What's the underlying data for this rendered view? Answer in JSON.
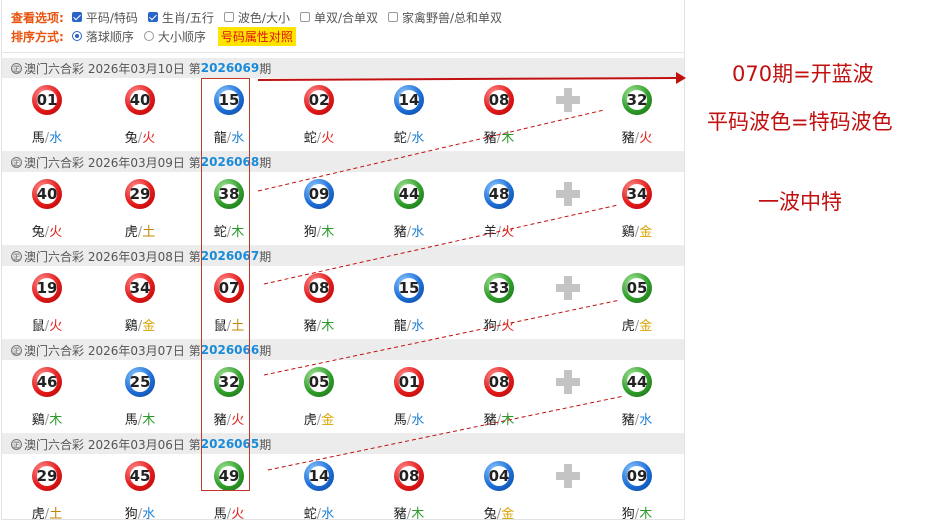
{
  "options": {
    "view_title": "查看选项:",
    "view_items": [
      {
        "label": "平码/特码",
        "checked": true
      },
      {
        "label": "生肖/五行",
        "checked": true
      },
      {
        "label": "波色/大小",
        "checked": false
      },
      {
        "label": "单双/合单双",
        "checked": false
      },
      {
        "label": "家禽野兽/总和单双",
        "checked": false
      }
    ],
    "sort_title": "排序方式:",
    "sort_items": [
      {
        "label": "落球顺序",
        "selected": true
      },
      {
        "label": "大小顺序",
        "selected": false
      }
    ],
    "attr_button": "号码属性对照"
  },
  "draws": [
    {
      "lottery": "澳门六合彩",
      "date": "2026年03月10日",
      "prefix": "第",
      "number": "2026069",
      "suffix": "期",
      "logo": "㊣",
      "balls": [
        {
          "n": "01",
          "c": "red",
          "zodiac": "馬",
          "el": "水"
        },
        {
          "n": "40",
          "c": "red",
          "zodiac": "兔",
          "el": "火"
        },
        {
          "n": "15",
          "c": "blue",
          "zodiac": "龍",
          "el": "水"
        },
        {
          "n": "02",
          "c": "red",
          "zodiac": "蛇",
          "el": "火"
        },
        {
          "n": "14",
          "c": "blue",
          "zodiac": "蛇",
          "el": "水"
        },
        {
          "n": "08",
          "c": "red",
          "zodiac": "豬",
          "el": "木"
        }
      ],
      "special": {
        "n": "32",
        "c": "green",
        "zodiac": "豬",
        "el": "火"
      }
    },
    {
      "lottery": "澳门六合彩",
      "date": "2026年03月09日",
      "prefix": "第",
      "number": "2026068",
      "suffix": "期",
      "logo": "㊣",
      "balls": [
        {
          "n": "40",
          "c": "red",
          "zodiac": "兔",
          "el": "火"
        },
        {
          "n": "29",
          "c": "red",
          "zodiac": "虎",
          "el": "土"
        },
        {
          "n": "38",
          "c": "green",
          "zodiac": "蛇",
          "el": "木"
        },
        {
          "n": "09",
          "c": "blue",
          "zodiac": "狗",
          "el": "木"
        },
        {
          "n": "44",
          "c": "green",
          "zodiac": "豬",
          "el": "水"
        },
        {
          "n": "48",
          "c": "blue",
          "zodiac": "羊",
          "el": "火"
        }
      ],
      "special": {
        "n": "34",
        "c": "red",
        "zodiac": "鷄",
        "el": "金"
      }
    },
    {
      "lottery": "澳门六合彩",
      "date": "2026年03月08日",
      "prefix": "第",
      "number": "2026067",
      "suffix": "期",
      "logo": "㊣",
      "balls": [
        {
          "n": "19",
          "c": "red",
          "zodiac": "鼠",
          "el": "火"
        },
        {
          "n": "34",
          "c": "red",
          "zodiac": "鷄",
          "el": "金"
        },
        {
          "n": "07",
          "c": "red",
          "zodiac": "鼠",
          "el": "土"
        },
        {
          "n": "08",
          "c": "red",
          "zodiac": "豬",
          "el": "木"
        },
        {
          "n": "15",
          "c": "blue",
          "zodiac": "龍",
          "el": "水"
        },
        {
          "n": "33",
          "c": "green",
          "zodiac": "狗",
          "el": "火"
        }
      ],
      "special": {
        "n": "05",
        "c": "green",
        "zodiac": "虎",
        "el": "金"
      }
    },
    {
      "lottery": "澳门六合彩",
      "date": "2026年03月07日",
      "prefix": "第",
      "number": "2026066",
      "suffix": "期",
      "logo": "㊣",
      "balls": [
        {
          "n": "46",
          "c": "red",
          "zodiac": "鷄",
          "el": "木"
        },
        {
          "n": "25",
          "c": "blue",
          "zodiac": "馬",
          "el": "木"
        },
        {
          "n": "32",
          "c": "green",
          "zodiac": "豬",
          "el": "火"
        },
        {
          "n": "05",
          "c": "green",
          "zodiac": "虎",
          "el": "金"
        },
        {
          "n": "01",
          "c": "red",
          "zodiac": "馬",
          "el": "水"
        },
        {
          "n": "08",
          "c": "red",
          "zodiac": "豬",
          "el": "木"
        }
      ],
      "special": {
        "n": "44",
        "c": "green",
        "zodiac": "豬",
        "el": "水"
      }
    },
    {
      "lottery": "澳门六合彩",
      "date": "2026年03月06日",
      "prefix": "第",
      "number": "2026065",
      "suffix": "期",
      "logo": "㊣",
      "balls": [
        {
          "n": "29",
          "c": "red",
          "zodiac": "虎",
          "el": "土"
        },
        {
          "n": "45",
          "c": "red",
          "zodiac": "狗",
          "el": "水"
        },
        {
          "n": "49",
          "c": "green",
          "zodiac": "馬",
          "el": "火"
        },
        {
          "n": "14",
          "c": "blue",
          "zodiac": "蛇",
          "el": "水"
        },
        {
          "n": "08",
          "c": "red",
          "zodiac": "豬",
          "el": "木"
        },
        {
          "n": "04",
          "c": "blue",
          "zodiac": "兔",
          "el": "金"
        }
      ],
      "special": {
        "n": "09",
        "c": "blue",
        "zodiac": "狗",
        "el": "木"
      }
    }
  ],
  "notes": {
    "line1": "070期=开蓝波",
    "line2": "平码波色=特码波色",
    "line3": "一波中特"
  },
  "colors": {
    "annotation": "#c01010",
    "red_ball": "#e41b1b",
    "blue_ball": "#1d6fd8",
    "green_ball": "#2f9f2a",
    "highlight_tag": "#ffe400"
  }
}
